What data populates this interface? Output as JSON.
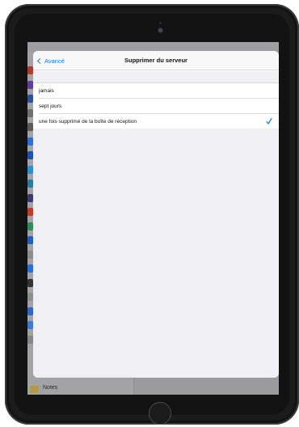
{
  "colors": {
    "accent": "#0a7aff",
    "check": "#0a7aff",
    "grouped_background": "#efeff4"
  },
  "navigation": {
    "back_label": "Avancé",
    "title": "Supprimer du serveur"
  },
  "options": [
    {
      "label": "jamais",
      "selected": false
    },
    {
      "label": "sept jours",
      "selected": false
    },
    {
      "label": "une fois supprimé de la boîte de réception",
      "selected": true
    }
  ],
  "background_app": {
    "partial_label": "Notes"
  },
  "icons": [
    "chevron-left-icon",
    "checkmark-icon",
    "camera-icon",
    "home-button"
  ]
}
